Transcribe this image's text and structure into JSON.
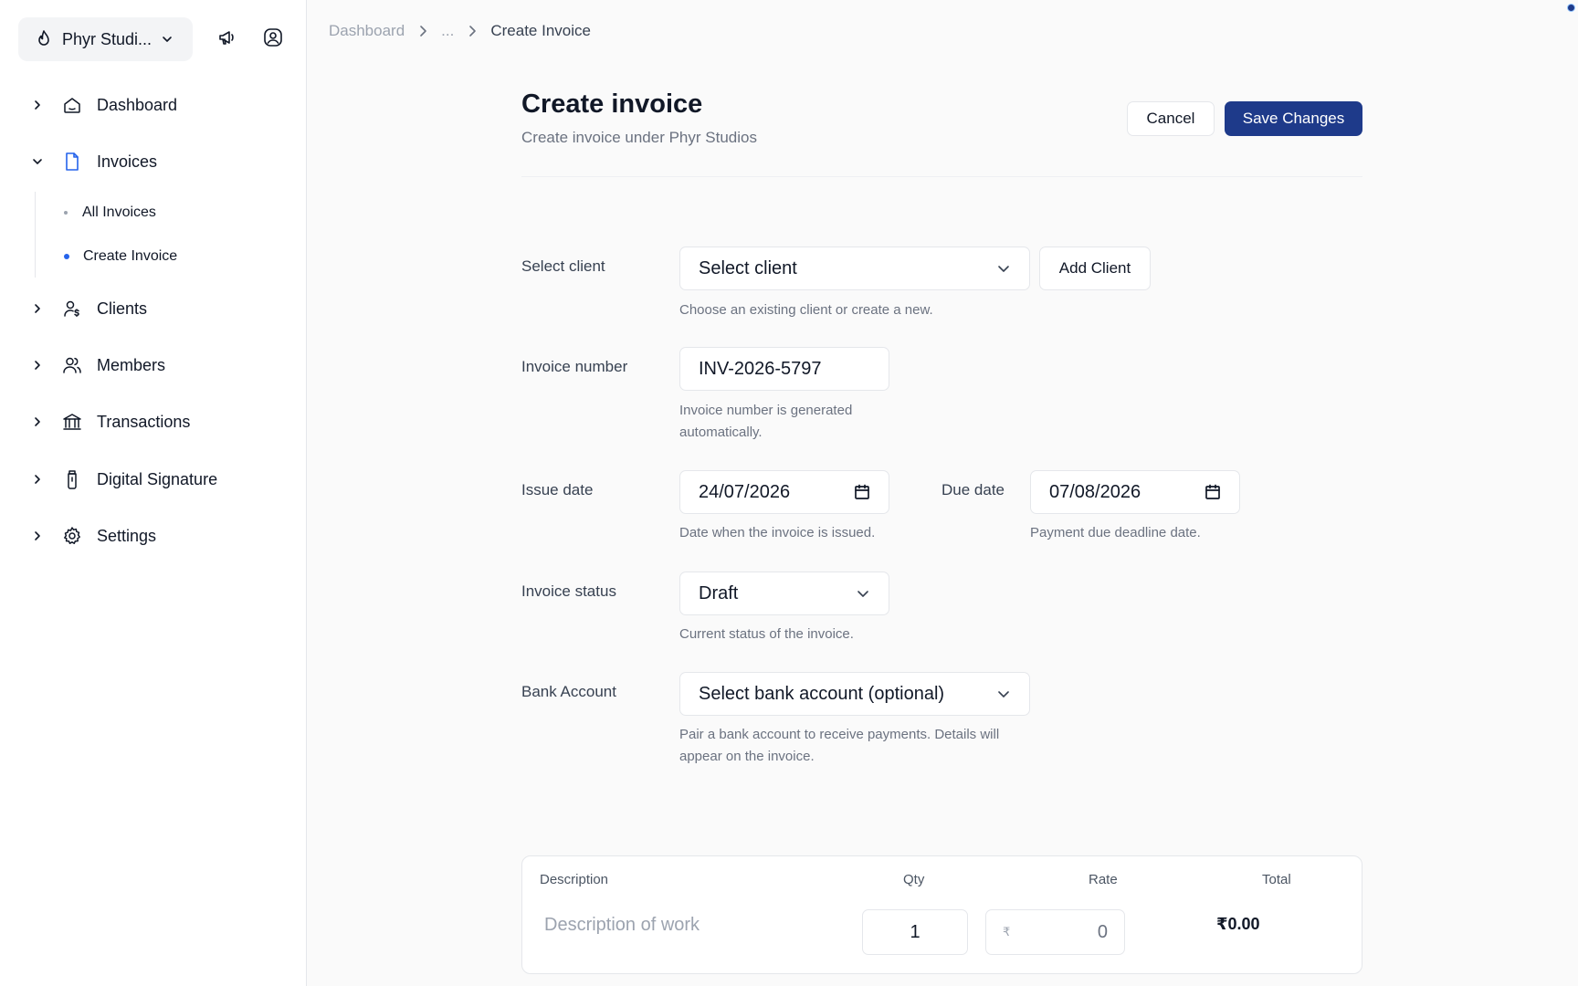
{
  "sidebar": {
    "org_name": "Phyr Studi...",
    "nav": [
      {
        "label": "Dashboard"
      },
      {
        "label": "Invoices"
      },
      {
        "label": "Clients"
      },
      {
        "label": "Members"
      },
      {
        "label": "Transactions"
      },
      {
        "label": "Digital Signature"
      },
      {
        "label": "Settings"
      }
    ],
    "sub_items": [
      {
        "label": "All Invoices",
        "active": false
      },
      {
        "label": "Create Invoice",
        "active": true
      }
    ]
  },
  "breadcrumb": {
    "items": [
      "Dashboard",
      "...",
      "Create Invoice"
    ]
  },
  "header": {
    "title": "Create invoice",
    "subtitle": "Create invoice under Phyr Studios",
    "cancel_label": "Cancel",
    "save_label": "Save Changes"
  },
  "form": {
    "client": {
      "label": "Select client",
      "value": "Select client",
      "add_label": "Add Client",
      "hint": "Choose an existing client or create a new."
    },
    "invoice_number": {
      "label": "Invoice number",
      "value": "INV-2026-5797",
      "hint_line1": "Invoice number is generated",
      "hint_line2": "automatically."
    },
    "issue_date": {
      "label": "Issue date",
      "value": "24/07/2026",
      "hint": "Date when the invoice is issued."
    },
    "due_date": {
      "label": "Due date",
      "value": "07/08/2026",
      "hint": "Payment due deadline date."
    },
    "status": {
      "label": "Invoice status",
      "value": "Draft",
      "hint": "Current status of the invoice."
    },
    "bank": {
      "label": "Bank Account",
      "value": "Select bank account (optional)",
      "hint_line1": "Pair a bank account to receive payments. Details will",
      "hint_line2": "appear on the invoice."
    }
  },
  "items_table": {
    "headers": {
      "description": "Description",
      "qty": "Qty",
      "rate": "Rate",
      "total": "Total"
    },
    "row": {
      "description_placeholder": "Description of work",
      "qty": "1",
      "currency": "₹",
      "rate": "0",
      "total": "₹0.00"
    }
  },
  "colors": {
    "primary": "#1e3a8a",
    "active_accent": "#2563eb"
  }
}
